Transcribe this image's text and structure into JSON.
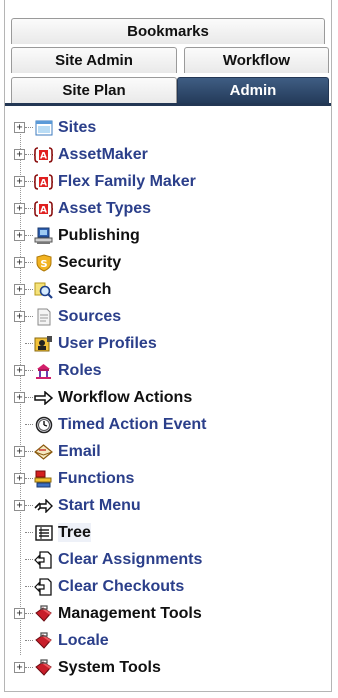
{
  "tabs": {
    "bookmarks": "Bookmarks",
    "site_admin": "Site Admin",
    "workflow": "Workflow",
    "site_plan": "Site Plan",
    "admin": "Admin"
  },
  "tree": {
    "sites": "Sites",
    "assetmaker": "AssetMaker",
    "flex_family_maker": "Flex Family Maker",
    "asset_types": "Asset Types",
    "publishing": "Publishing",
    "security": "Security",
    "search": "Search",
    "sources": "Sources",
    "user_profiles": "User Profiles",
    "roles": "Roles",
    "workflow_actions": "Workflow Actions",
    "timed_action_event": "Timed Action Event",
    "email": "Email",
    "functions": "Functions",
    "start_menu": "Start Menu",
    "tree": "Tree",
    "clear_assignments": "Clear Assignments",
    "clear_checkouts": "Clear Checkouts",
    "management_tools": "Management Tools",
    "locale": "Locale",
    "system_tools": "System Tools"
  },
  "expander_symbol": "+",
  "colors": {
    "active_tab": "#2f4a6e",
    "link_blue": "#2b3f8a",
    "text_black": "#111111"
  }
}
